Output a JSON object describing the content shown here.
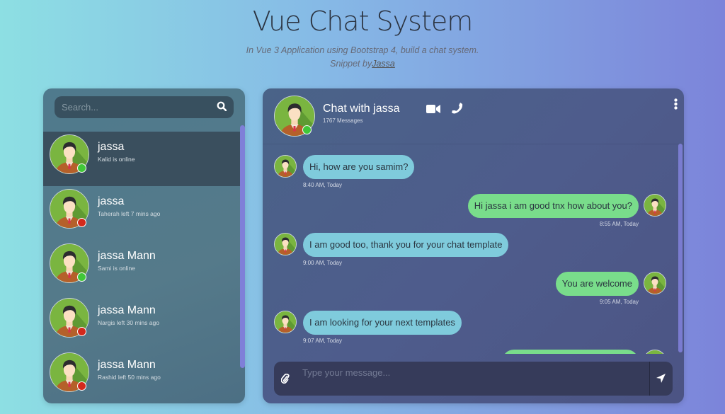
{
  "page": {
    "title": "Vue Chat System",
    "subtitle": "In Vue 3 Application using Bootstrap 4, build a chat system.",
    "credit_prefix": "Snippet by",
    "credit_link": "Jassa"
  },
  "sidebar": {
    "search_placeholder": "Search...",
    "search_icon": "search-icon",
    "contacts": [
      {
        "name": "jassa",
        "status": "Kalid is online",
        "online": true,
        "active": true
      },
      {
        "name": "jassa",
        "status": "Taherah left 7 mins ago",
        "online": false
      },
      {
        "name": "jassa Mann",
        "status": "Sami is online",
        "online": true
      },
      {
        "name": "jassa Mann",
        "status": "Nargis left 30 mins ago",
        "online": false
      },
      {
        "name": "jassa Mann",
        "status": "Rashid left 50 mins ago",
        "online": false
      }
    ]
  },
  "chat": {
    "title": "Chat with jassa",
    "count": "1767 Messages",
    "online": true,
    "messages": [
      {
        "dir": "received",
        "text": "Hi, how are you samim?",
        "time": "8:40 AM, Today"
      },
      {
        "dir": "sent",
        "text": "Hi jassa i am good tnx how about you?",
        "time": "8:55 AM, Today"
      },
      {
        "dir": "received",
        "text": "I am good too, thank you for your chat template",
        "time": "9:00 AM, Today"
      },
      {
        "dir": "sent",
        "text": "You are welcome",
        "time": "9:05 AM, Today"
      },
      {
        "dir": "received",
        "text": "I am looking for your next templates",
        "time": "9:07 AM, Today"
      }
    ],
    "input_placeholder": "Type your message..."
  },
  "colors": {
    "received": "#7fcbdc",
    "sent": "#79dd8b",
    "online": "#41c738",
    "offline": "#d3291c",
    "scrollbar": "#7f7fd8"
  }
}
